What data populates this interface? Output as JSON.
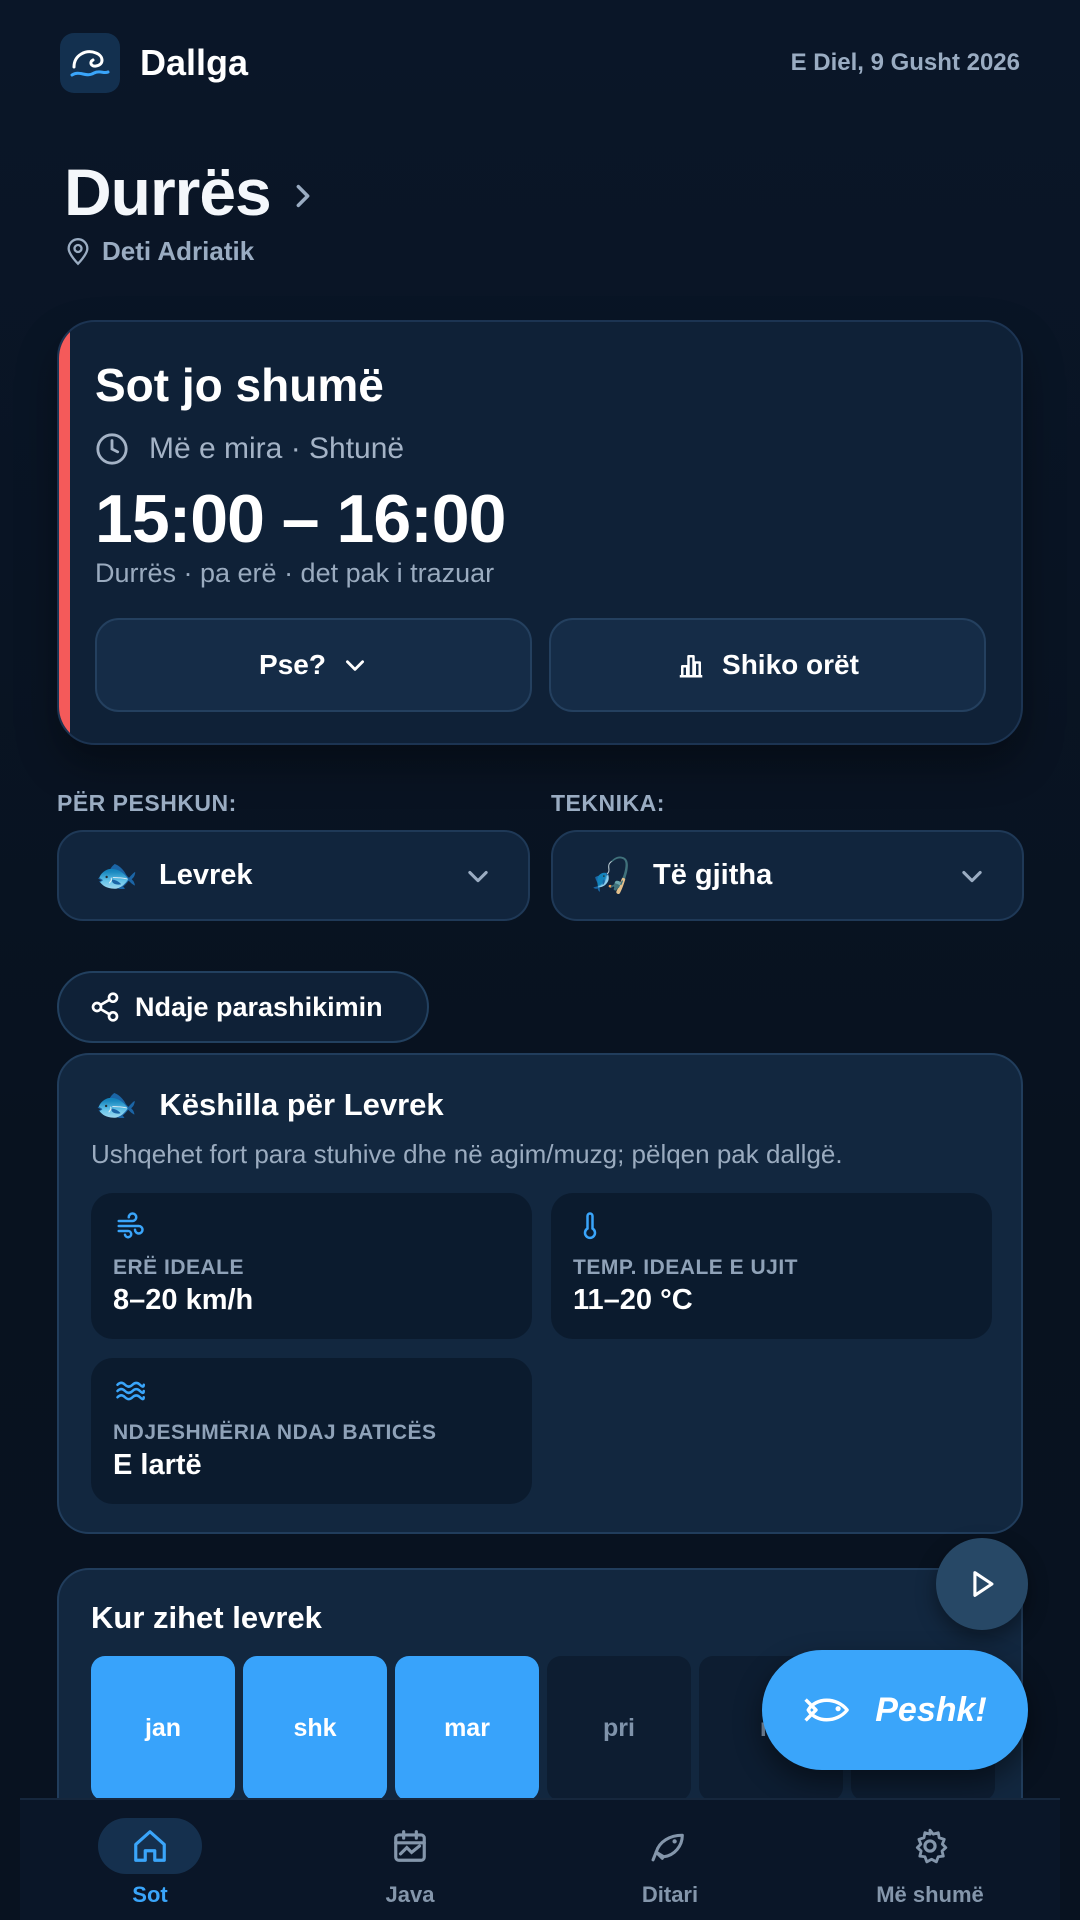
{
  "app": {
    "name": "Dallga",
    "date": "E Diel, 9 Gusht 2026"
  },
  "location": {
    "city": "Durrës",
    "region": "Deti Adriatik"
  },
  "forecast": {
    "title": "Sot jo shumë",
    "best_label": "Më e mira · Shtunë",
    "time_window": "15:00 – 16:00",
    "conditions": "Durrës · pa erë · det pak i trazuar",
    "why_button": "Pse?",
    "hours_button": "Shiko orët",
    "accent_color": "#f45a5a"
  },
  "selectors": {
    "fish": {
      "label": "PËR PESHKUN:",
      "value": "Levrek",
      "emoji": "🐟"
    },
    "technique": {
      "label": "TEKNIKA:",
      "value": "Të gjitha",
      "emoji": "🎣"
    }
  },
  "share": {
    "label": "Ndaje parashikimin"
  },
  "tips": {
    "emoji": "🐟",
    "title": "Këshilla për Levrek",
    "description": "Ushqehet fort para stuhive dhe në agim/muzg; pëlqen pak dallgë.",
    "tiles": [
      {
        "icon": "wind-icon",
        "label": "ERË IDEALE",
        "value": "8–20 km/h"
      },
      {
        "icon": "thermometer-icon",
        "label": "TEMP. IDEALE E UJIT",
        "value": "11–20 °C"
      },
      {
        "icon": "waves-icon",
        "label": "NDJESHMËRIA NDAJ BATICËS",
        "value": "E lartë"
      }
    ]
  },
  "season": {
    "title": "Kur zihet levrek",
    "months": [
      {
        "label": "jan",
        "active": true
      },
      {
        "label": "shk",
        "active": true
      },
      {
        "label": "mar",
        "active": true
      },
      {
        "label": "pri",
        "active": false
      },
      {
        "label": "m",
        "active": false
      },
      {
        "label": "",
        "active": false
      }
    ]
  },
  "fab": {
    "label": "Peshk!"
  },
  "nav": {
    "items": [
      {
        "label": "Sot",
        "icon": "home-icon",
        "active": true
      },
      {
        "label": "Java",
        "icon": "calendar-icon",
        "active": false
      },
      {
        "label": "Ditari",
        "icon": "fish-icon",
        "active": false
      },
      {
        "label": "Më shumë",
        "icon": "gear-icon",
        "active": false
      }
    ]
  },
  "colors": {
    "accent": "#3aa5fa",
    "background": "#08111f",
    "card": "#0f2137",
    "warning": "#f45a5a"
  }
}
